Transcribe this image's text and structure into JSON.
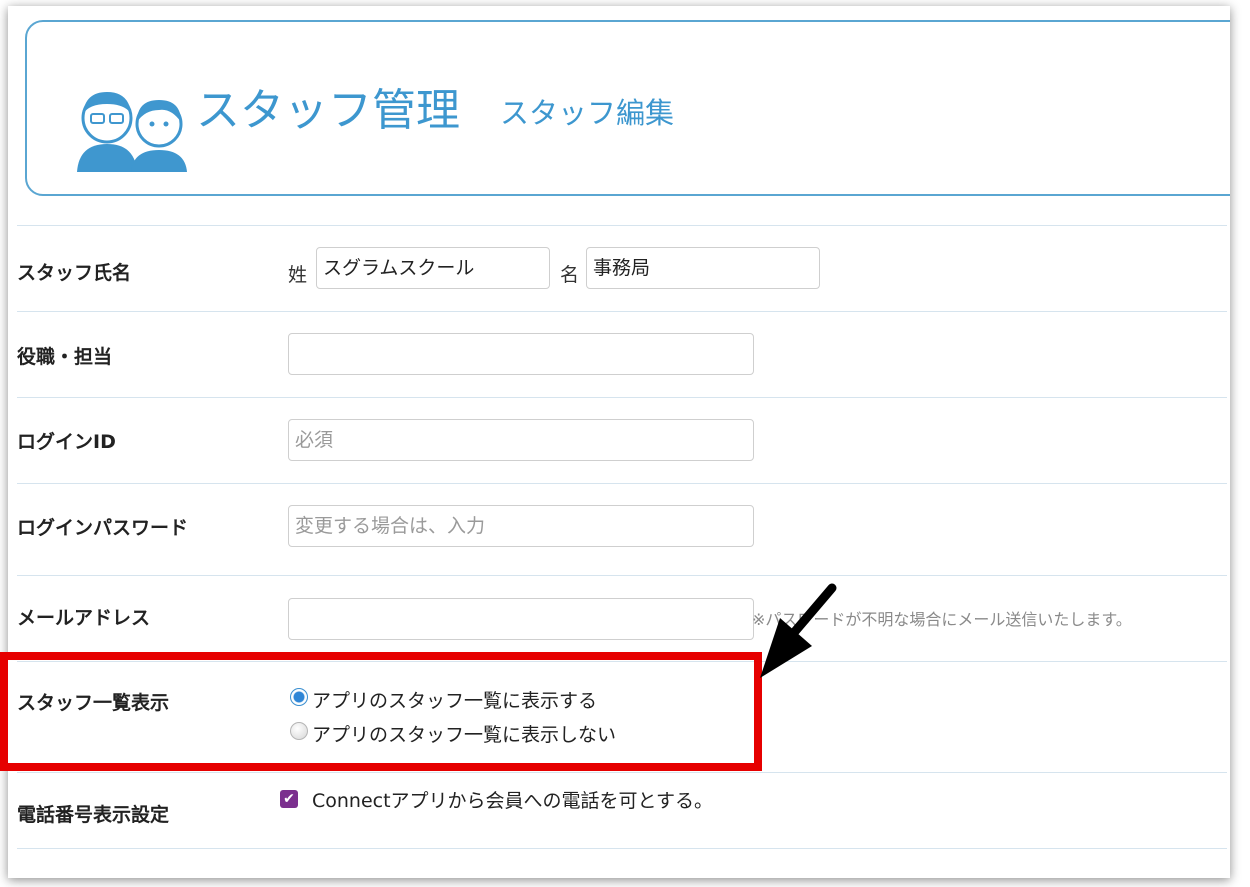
{
  "header": {
    "title": "スタッフ管理",
    "subtitle": "スタッフ編集"
  },
  "rows": {
    "name": {
      "label": "スタッフ氏名",
      "last_prefix": "姓",
      "last_value": "スグラムスクール",
      "first_prefix": "名",
      "first_value": "事務局"
    },
    "role": {
      "label": "役職・担当",
      "value": ""
    },
    "login_id": {
      "label": "ログインID",
      "placeholder": "必須"
    },
    "login_password": {
      "label": "ログインパスワード",
      "placeholder": "変更する場合は、入力"
    },
    "email": {
      "label": "メールアドレス",
      "value": "",
      "note": "※パスワードが不明な場合にメール送信いたします。"
    },
    "staff_list": {
      "label": "スタッフ一覧表示",
      "options": [
        "アプリのスタッフ一覧に表示する",
        "アプリのスタッフ一覧に表示しない"
      ],
      "selected": 0
    },
    "phone": {
      "label": "電話番号表示設定",
      "checkbox_label": "Connectアプリから会員への電話を可とする。",
      "checked": true
    }
  },
  "colors": {
    "accent": "#3d97cf",
    "highlight": "#e60000",
    "checkbox": "#7b2f8e"
  },
  "icons": {
    "avatar": "staff-avatar-icon",
    "arrow": "annotation-arrow-icon",
    "check": "check-icon"
  }
}
